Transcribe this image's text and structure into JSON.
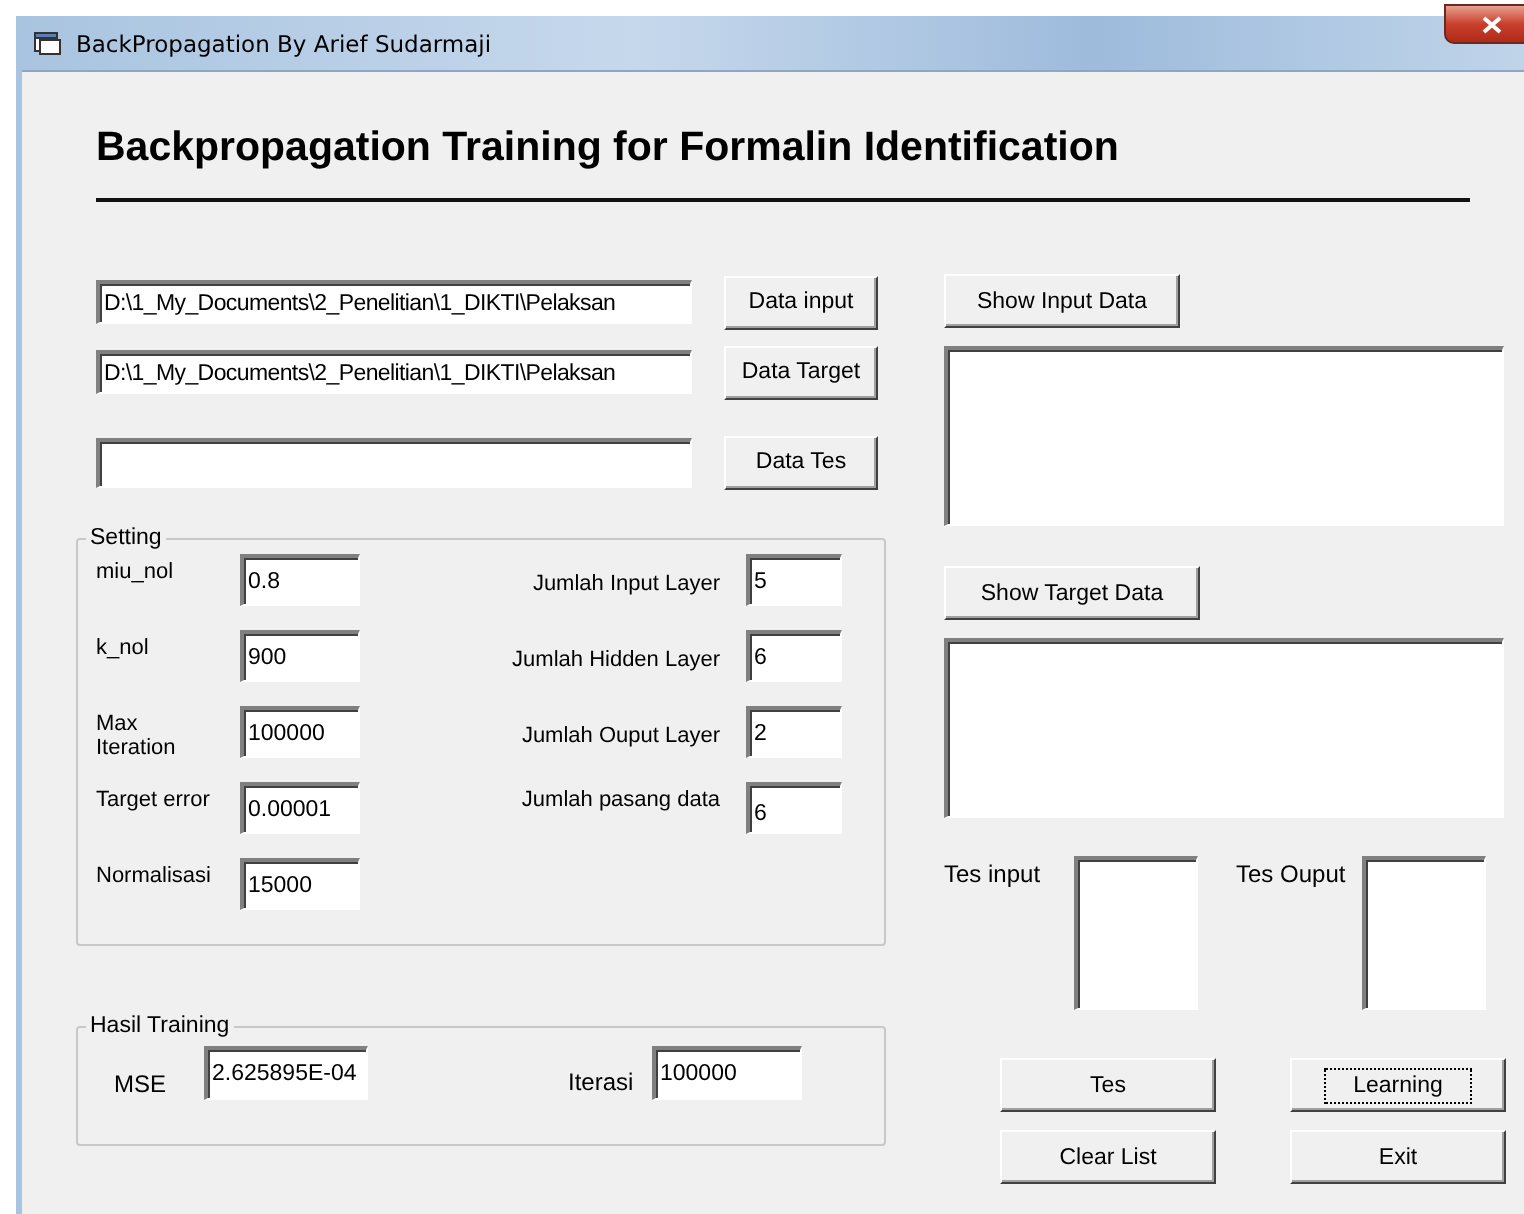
{
  "window": {
    "title": "BackPropagation By Arief Sudarmaji"
  },
  "heading": "Backpropagation Training for Formalin Identification",
  "files": [
    {
      "value": "D:\\1_My_Documents\\2_Penelitian\\1_DIKTI\\Pelaksan",
      "button": "Data input"
    },
    {
      "value": "D:\\1_My_Documents\\2_Penelitian\\1_DIKTI\\Pelaksan",
      "button": "Data Target"
    },
    {
      "button": "Data Tes"
    }
  ],
  "setting": {
    "title": "Setting",
    "left": [
      {
        "label": "miu_nol",
        "value": "0.8"
      },
      {
        "label": "k_nol",
        "value": "900"
      },
      {
        "label": "Max Iteration",
        "value": "100000"
      },
      {
        "label": "Target error",
        "value": "0.00001"
      },
      {
        "label": "Normalisasi",
        "value": "15000"
      }
    ],
    "right": [
      {
        "label": "Jumlah Input Layer",
        "value": "5"
      },
      {
        "label": "Jumlah Hidden Layer",
        "value": "6"
      },
      {
        "label": "Jumlah Ouput Layer",
        "value": "2"
      },
      {
        "label": "Jumlah pasang data",
        "value": "6"
      }
    ]
  },
  "result": {
    "title": "Hasil Training",
    "mse": {
      "label": "MSE",
      "value": "2.625895E-04"
    },
    "iterations": {
      "label": "Iterasi",
      "value": "100000"
    }
  },
  "show_input": {
    "button": "Show Input Data"
  },
  "show_target": {
    "button": "Show Target Data"
  },
  "tes_input": {
    "label": "Tes input"
  },
  "tes_output": {
    "label": "Tes Ouput"
  },
  "buttons": [
    {
      "label": "Tes",
      "focused": false
    },
    {
      "label": "Learning",
      "focused": true
    },
    {
      "label": "Clear List",
      "focused": false
    },
    {
      "label": "Exit",
      "focused": false
    }
  ]
}
